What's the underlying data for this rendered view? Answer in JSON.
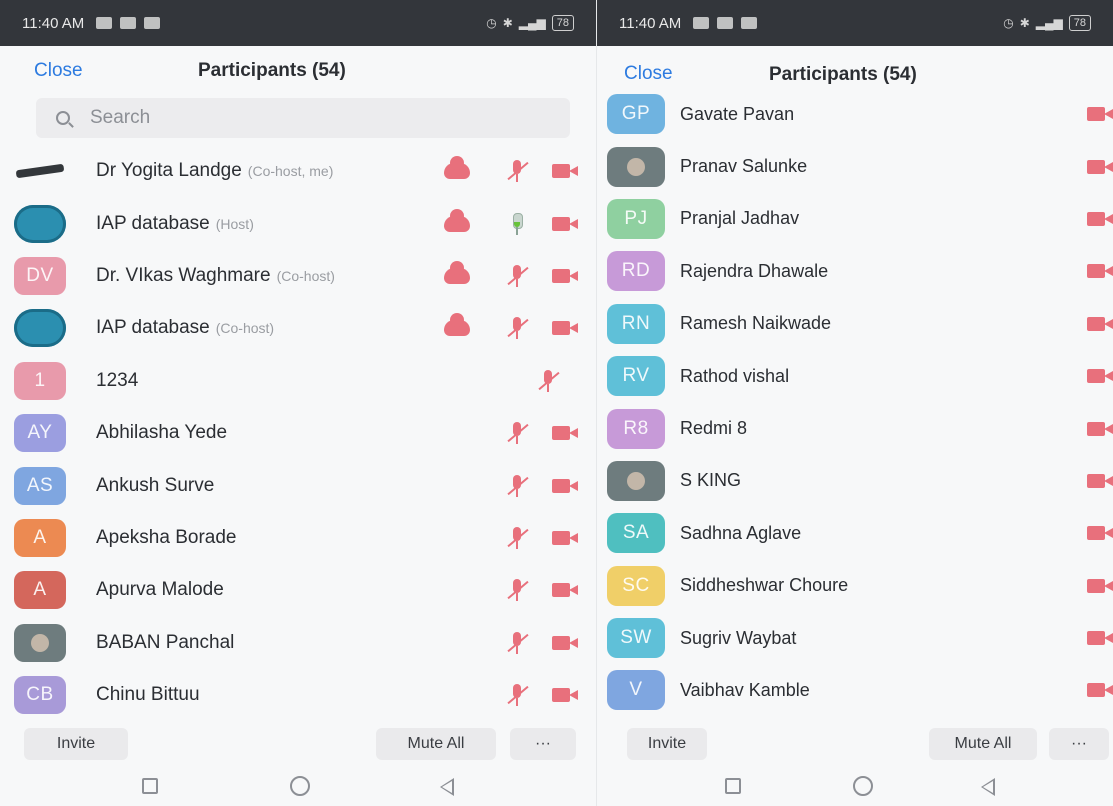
{
  "colors": {
    "accent": "#2d7be0",
    "muted_red": "#e8707c",
    "statusbar": "#33363b"
  },
  "left": {
    "status": {
      "time": "11:40 AM",
      "battery": "78"
    },
    "header": {
      "close_label": "Close",
      "title": "Participants (54)"
    },
    "search": {
      "placeholder": "Search"
    },
    "participants": [
      {
        "initials": "",
        "avatar": "gun",
        "color": "",
        "name": "Dr Yogita Landge",
        "role": "(Co-host, me)",
        "cloud": true,
        "mic": "muted",
        "video": "off"
      },
      {
        "initials": "",
        "avatar": "round-logo",
        "color": "",
        "name": "IAP database",
        "role": "(Host)",
        "cloud": true,
        "mic": "on",
        "video": "off"
      },
      {
        "initials": "DV",
        "avatar": "initials",
        "color": "#e89aab",
        "name": "Dr. VIkas Waghmare",
        "role": "(Co-host)",
        "cloud": true,
        "mic": "muted",
        "video": "off"
      },
      {
        "initials": "",
        "avatar": "round-logo",
        "color": "",
        "name": "IAP database",
        "role": "(Co-host)",
        "cloud": true,
        "mic": "muted",
        "video": "off"
      },
      {
        "initials": "1",
        "avatar": "initials",
        "color": "#e89aab",
        "name": "1234",
        "role": "",
        "cloud": false,
        "mic": "muted",
        "video": "none"
      },
      {
        "initials": "AY",
        "avatar": "initials",
        "color": "#9b9ee0",
        "name": "Abhilasha Yede",
        "role": "",
        "cloud": false,
        "mic": "muted",
        "video": "off"
      },
      {
        "initials": "AS",
        "avatar": "initials",
        "color": "#7fa6e0",
        "name": "Ankush Surve",
        "role": "",
        "cloud": false,
        "mic": "muted",
        "video": "off"
      },
      {
        "initials": "A",
        "avatar": "initials",
        "color": "#ec8a52",
        "name": "Apeksha Borade",
        "role": "",
        "cloud": false,
        "mic": "muted",
        "video": "off"
      },
      {
        "initials": "A",
        "avatar": "initials",
        "color": "#d4675c",
        "name": "Apurva Malode",
        "role": "",
        "cloud": false,
        "mic": "muted",
        "video": "off"
      },
      {
        "initials": "",
        "avatar": "photo",
        "color": "",
        "name": "BABAN Panchal",
        "role": "",
        "cloud": false,
        "mic": "muted",
        "video": "off"
      },
      {
        "initials": "CB",
        "avatar": "initials",
        "color": "#a89ad8",
        "name": "Chinu Bittuu",
        "role": "",
        "cloud": false,
        "mic": "muted",
        "video": "off"
      }
    ],
    "footer": {
      "invite_label": "Invite",
      "mute_all_label": "Mute All",
      "more_label": "···"
    }
  },
  "right": {
    "status": {
      "time": "11:40 AM",
      "battery": "78"
    },
    "header": {
      "close_label": "Close",
      "title": "Participants (54)"
    },
    "participants": [
      {
        "initials": "GP",
        "avatar": "initials",
        "color": "#6fb3e0",
        "name": "Gavate Pavan"
      },
      {
        "initials": "",
        "avatar": "photo",
        "color": "",
        "name": "Pranav Salunke"
      },
      {
        "initials": "PJ",
        "avatar": "initials",
        "color": "#8fd0a0",
        "name": "Pranjal Jadhav"
      },
      {
        "initials": "RD",
        "avatar": "initials",
        "color": "#c79ad8",
        "name": "Rajendra Dhawale"
      },
      {
        "initials": "RN",
        "avatar": "initials",
        "color": "#5fc0d8",
        "name": "Ramesh Naikwade"
      },
      {
        "initials": "RV",
        "avatar": "initials",
        "color": "#5fc0d8",
        "name": "Rathod vishal"
      },
      {
        "initials": "R8",
        "avatar": "initials",
        "color": "#c79ad8",
        "name": "Redmi 8"
      },
      {
        "initials": "",
        "avatar": "photo",
        "color": "",
        "name": "S KING"
      },
      {
        "initials": "SA",
        "avatar": "initials",
        "color": "#4fbfc0",
        "name": "Sadhna Aglave"
      },
      {
        "initials": "SC",
        "avatar": "initials",
        "color": "#f0cf68",
        "name": "Siddheshwar Choure"
      },
      {
        "initials": "SW",
        "avatar": "initials",
        "color": "#5fc0d8",
        "name": "Sugriv Waybat"
      },
      {
        "initials": "V",
        "avatar": "initials",
        "color": "#7fa6e0",
        "name": "Vaibhav Kamble"
      }
    ],
    "footer": {
      "invite_label": "Invite",
      "mute_all_label": "Mute All",
      "more_label": "···"
    }
  }
}
